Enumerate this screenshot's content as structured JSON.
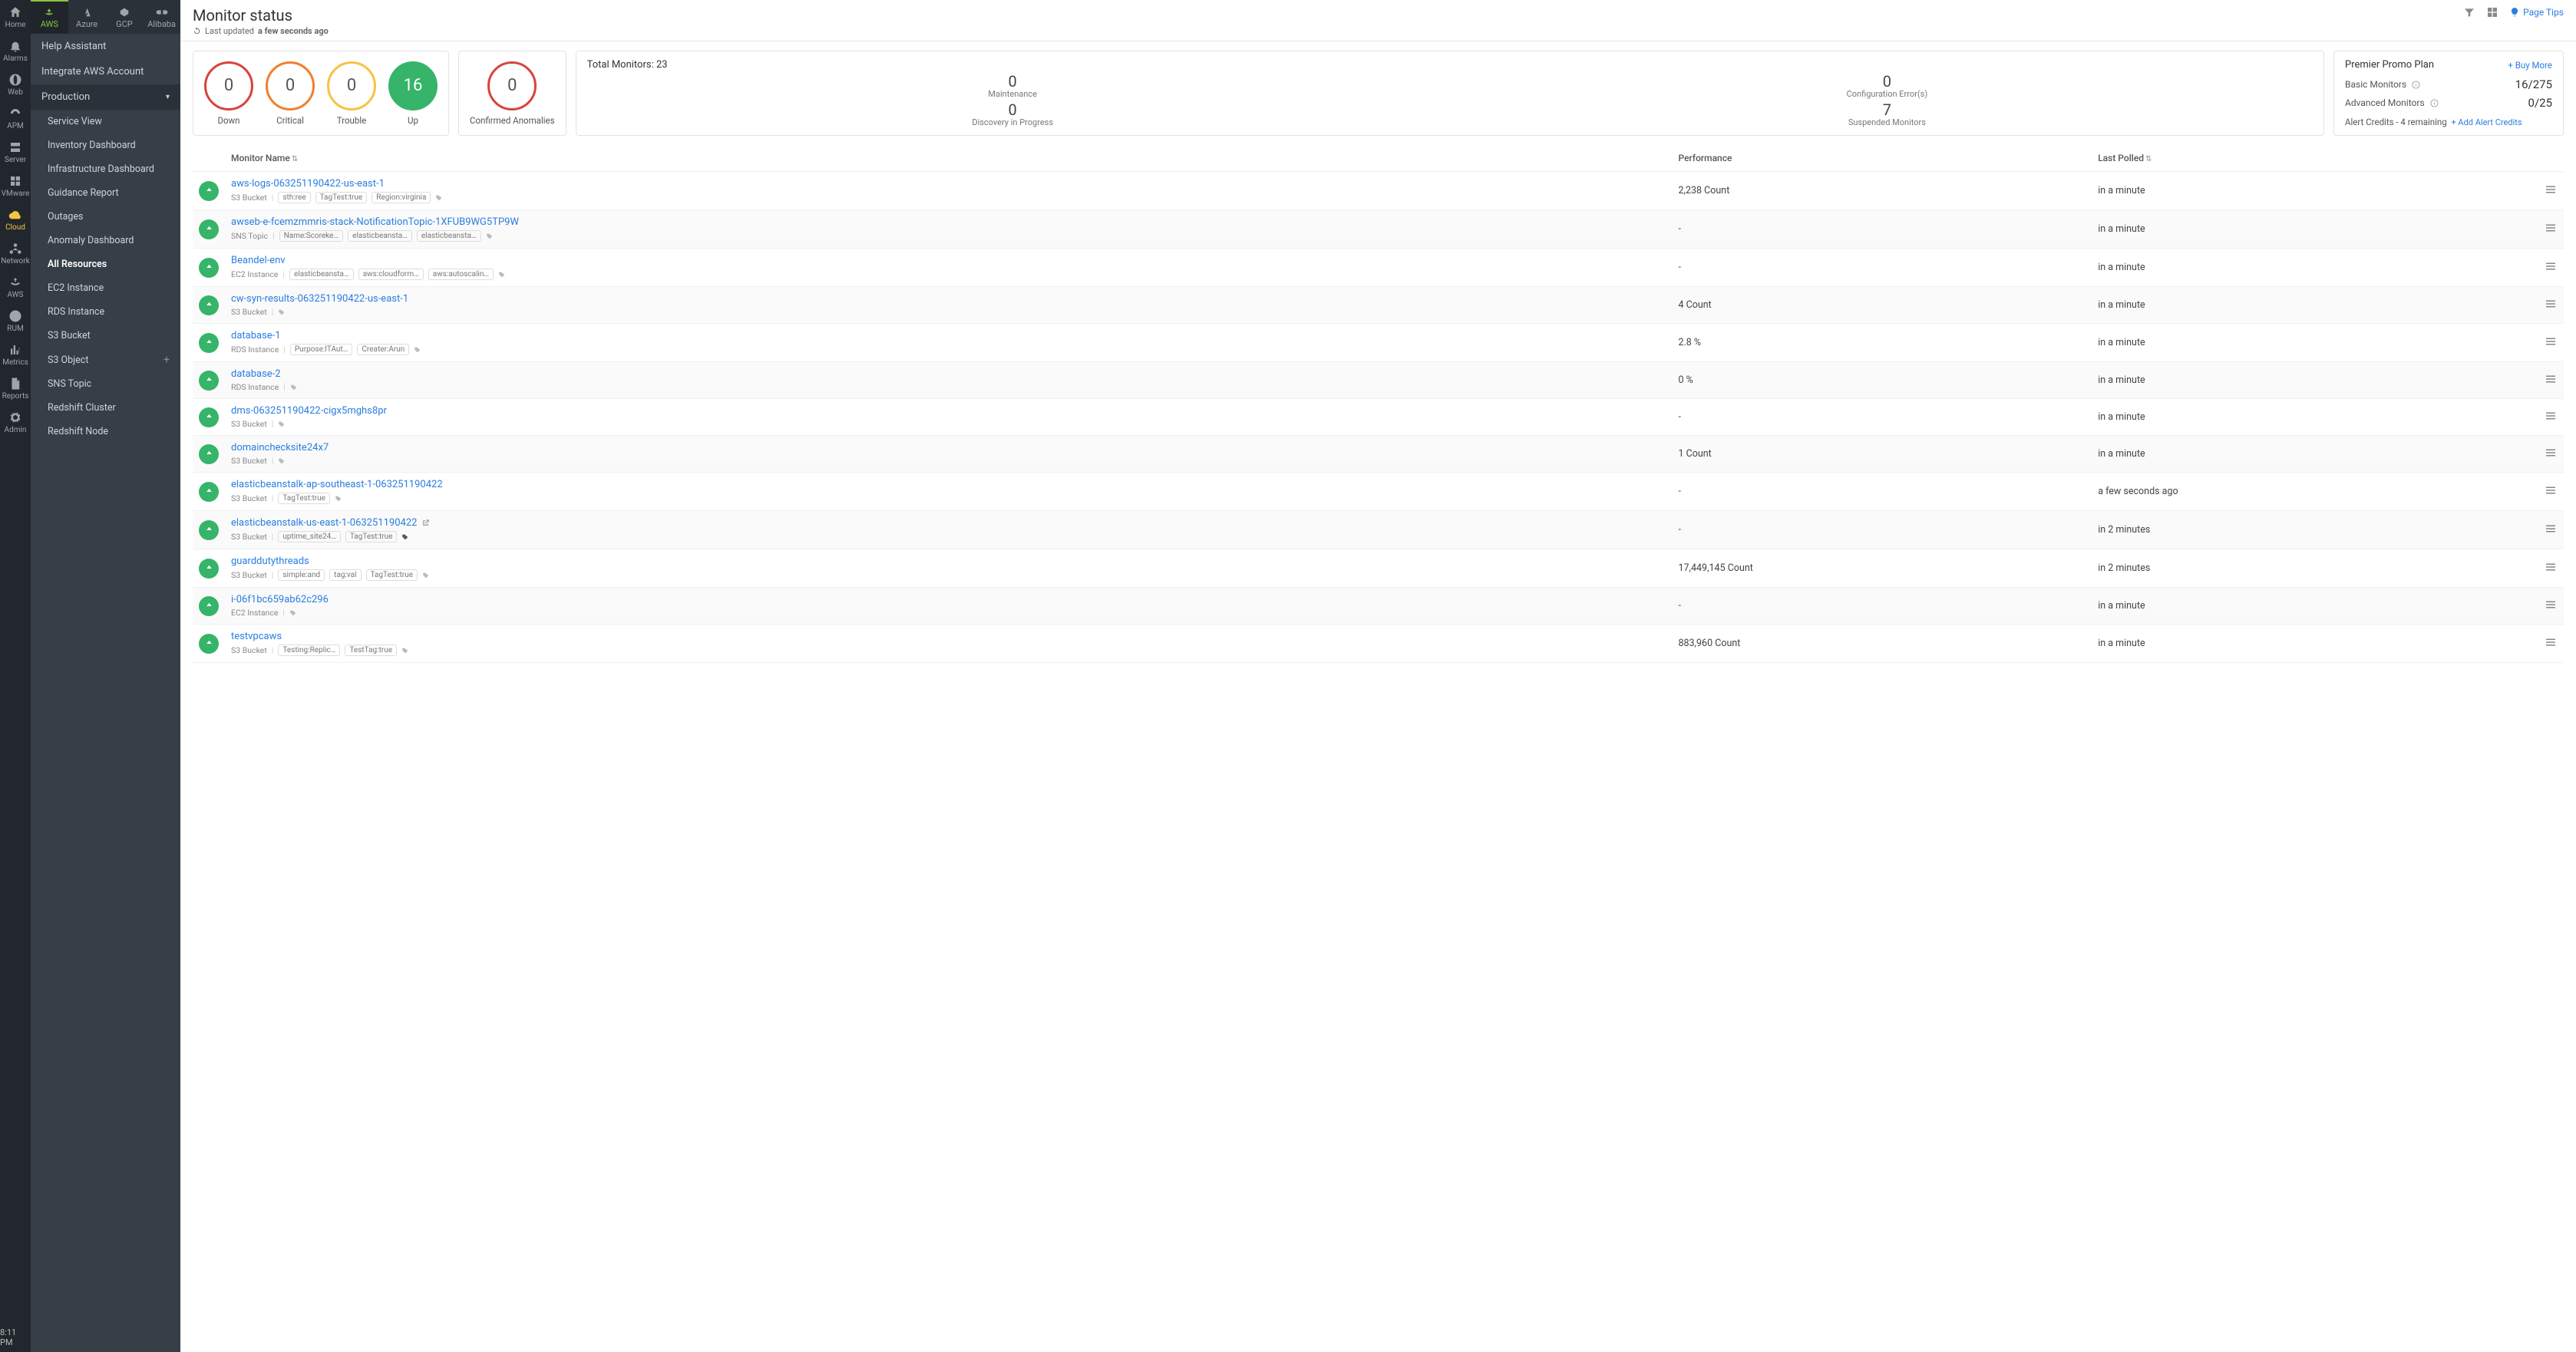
{
  "rail": {
    "items": [
      {
        "id": "home",
        "label": "Home"
      },
      {
        "id": "alarms",
        "label": "Alarms"
      },
      {
        "id": "web",
        "label": "Web"
      },
      {
        "id": "apm",
        "label": "APM"
      },
      {
        "id": "server",
        "label": "Server"
      },
      {
        "id": "vmware",
        "label": "VMware"
      },
      {
        "id": "cloud",
        "label": "Cloud"
      },
      {
        "id": "network",
        "label": "Network"
      },
      {
        "id": "aws",
        "label": "AWS"
      },
      {
        "id": "rum",
        "label": "RUM"
      },
      {
        "id": "metrics",
        "label": "Metrics"
      },
      {
        "id": "reports",
        "label": "Reports"
      },
      {
        "id": "admin",
        "label": "Admin"
      }
    ],
    "active": "cloud",
    "time": "8:11 PM"
  },
  "cloud_tabs": [
    {
      "id": "aws",
      "label": "AWS",
      "active": true
    },
    {
      "id": "azure",
      "label": "Azure"
    },
    {
      "id": "gcp",
      "label": "GCP"
    },
    {
      "id": "alibaba",
      "label": "Alibaba"
    }
  ],
  "leftpanel": {
    "top": [
      {
        "id": "help",
        "label": "Help Assistant"
      },
      {
        "id": "integrate",
        "label": "Integrate AWS Account"
      }
    ],
    "section": {
      "label": "Production",
      "open": true
    },
    "subs": [
      {
        "id": "svc",
        "label": "Service View"
      },
      {
        "id": "inv",
        "label": "Inventory Dashboard"
      },
      {
        "id": "infra",
        "label": "Infrastructure Dashboard"
      },
      {
        "id": "guide",
        "label": "Guidance Report"
      },
      {
        "id": "out",
        "label": "Outages"
      },
      {
        "id": "anom",
        "label": "Anomaly Dashboard"
      },
      {
        "id": "all",
        "label": "All Resources",
        "active": true
      },
      {
        "id": "ec2",
        "label": "EC2 Instance"
      },
      {
        "id": "rds",
        "label": "RDS Instance"
      },
      {
        "id": "s3b",
        "label": "S3 Bucket"
      },
      {
        "id": "s3o",
        "label": "S3 Object",
        "plus": true
      },
      {
        "id": "sns",
        "label": "SNS Topic"
      },
      {
        "id": "rsc",
        "label": "Redshift Cluster"
      },
      {
        "id": "rsn",
        "label": "Redshift Node"
      }
    ]
  },
  "page": {
    "title": "Monitor status",
    "updated_label": "Last updated",
    "updated_value": "a few seconds ago",
    "page_tips": "Page Tips"
  },
  "status_rings": [
    {
      "id": "down",
      "label": "Down",
      "value": "0"
    },
    {
      "id": "critical",
      "label": "Critical",
      "value": "0"
    },
    {
      "id": "trouble",
      "label": "Trouble",
      "value": "0"
    },
    {
      "id": "up",
      "label": "Up",
      "value": "16"
    }
  ],
  "anomaly": {
    "label": "Confirmed Anomalies",
    "value": "0"
  },
  "totals": {
    "title": "Total Monitors: 23",
    "cells": [
      {
        "value": "0",
        "label": "Maintenance"
      },
      {
        "value": "0",
        "label": "Configuration Error(s)"
      },
      {
        "value": "0",
        "label": "Discovery in Progress"
      },
      {
        "value": "7",
        "label": "Suspended Monitors"
      }
    ]
  },
  "promo": {
    "title": "Premier Promo Plan",
    "buy": "+ Buy More",
    "rows": [
      {
        "label": "Basic Monitors",
        "value": "16/275"
      },
      {
        "label": "Advanced Monitors",
        "value": "0/25"
      }
    ],
    "credits": "Alert Credits - 4 remaining",
    "credits_link": "+ Add Alert Credits"
  },
  "table": {
    "cols": {
      "name": "Monitor Name",
      "perf": "Performance",
      "polled": "Last Polled"
    },
    "rows": [
      {
        "name": "aws-logs-063251190422-us-east-1",
        "type": "S3 Bucket",
        "tags": [
          "sth:ree",
          "TagTest:true",
          "Region:virginia"
        ],
        "perf": "2,238 Count",
        "polled": "in a minute"
      },
      {
        "name": "awseb-e-fcemzmmris-stack-NotificationTopic-1XFUB9WG5TP9W",
        "type": "SNS Topic",
        "tags": [
          "Name:Scoreke…",
          "elasticbeansta…",
          "elasticbeansta…"
        ],
        "perf": "-",
        "polled": "in a minute"
      },
      {
        "name": "Beandel-env",
        "type": "EC2 Instance",
        "tags": [
          "elasticbeansta…",
          "aws:cloudform…",
          "aws:autoscalin…"
        ],
        "perf": "-",
        "polled": "in a minute"
      },
      {
        "name": "cw-syn-results-063251190422-us-east-1",
        "type": "S3 Bucket",
        "tags": [],
        "perf": "4 Count",
        "polled": "in a minute"
      },
      {
        "name": "database-1",
        "type": "RDS Instance",
        "tags": [
          "Purpose:ITAut…",
          "Creater:Arun"
        ],
        "perf": "2.8 %",
        "polled": "in a minute"
      },
      {
        "name": "database-2",
        "type": "RDS Instance",
        "tags": [],
        "perf": "0 %",
        "polled": "in a minute"
      },
      {
        "name": "dms-063251190422-cigx5mghs8pr",
        "type": "S3 Bucket",
        "tags": [],
        "perf": "-",
        "polled": "in a minute"
      },
      {
        "name": "domainchecksite24x7",
        "type": "S3 Bucket",
        "tags": [],
        "perf": "1 Count",
        "polled": "in a minute"
      },
      {
        "name": "elasticbeanstalk-ap-southeast-1-063251190422",
        "type": "S3 Bucket",
        "tags": [
          "TagTest:true"
        ],
        "perf": "-",
        "polled": "a few seconds ago"
      },
      {
        "name": "elasticbeanstalk-us-east-1-063251190422",
        "type": "S3 Bucket",
        "tags": [
          "uptime_site24…",
          "TagTest:true"
        ],
        "perf": "-",
        "polled": "in 2 minutes",
        "ext": true,
        "solidTag": true,
        "menuSolid": true
      },
      {
        "name": "guarddutythreads",
        "type": "S3 Bucket",
        "tags": [
          "simple:and",
          "tag:val",
          "TagTest:true"
        ],
        "perf": "17,449,145 Count",
        "polled": "in 2 minutes"
      },
      {
        "name": "i-06f1bc659ab62c296",
        "type": "EC2 Instance",
        "tags": [],
        "perf": "-",
        "polled": "in a minute"
      },
      {
        "name": "testvpcaws",
        "type": "S3 Bucket",
        "tags": [
          "Testing:Replic…",
          "TestTag:true"
        ],
        "perf": "883,960 Count",
        "polled": "in a minute"
      }
    ]
  }
}
